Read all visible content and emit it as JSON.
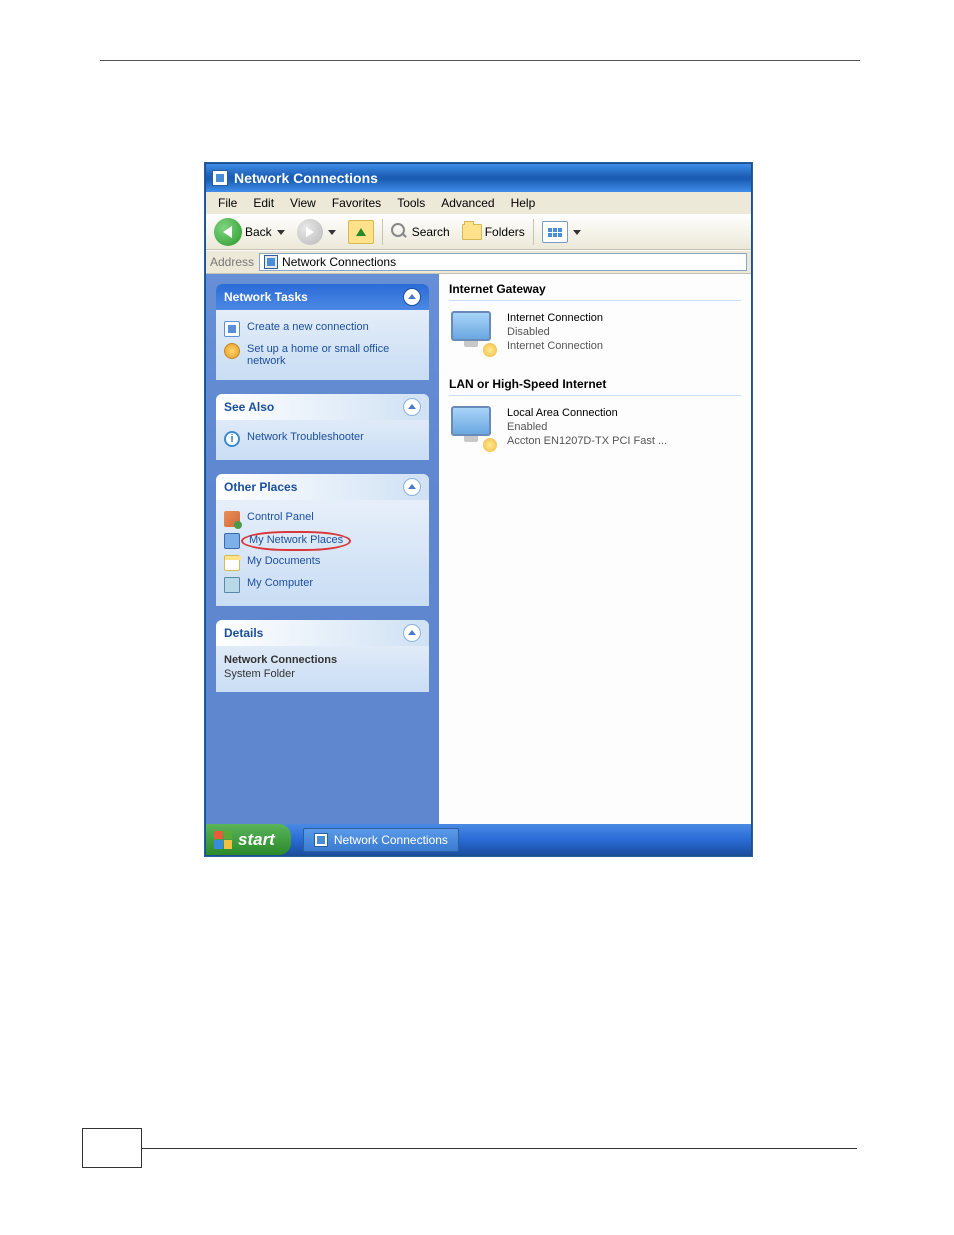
{
  "window_title": "Network Connections",
  "menu": {
    "file": "File",
    "edit": "Edit",
    "view": "View",
    "favorites": "Favorites",
    "tools": "Tools",
    "advanced": "Advanced",
    "help": "Help"
  },
  "toolbar": {
    "back": "Back",
    "search": "Search",
    "folders": "Folders"
  },
  "addressbar": {
    "label": "Address",
    "value": "Network Connections"
  },
  "sidebar": {
    "tasks": {
      "title": "Network Tasks",
      "items": [
        {
          "label": "Create a new connection"
        },
        {
          "label": "Set up a home or small office network"
        }
      ]
    },
    "seealso": {
      "title": "See Also",
      "items": [
        {
          "label": "Network Troubleshooter"
        }
      ]
    },
    "other": {
      "title": "Other Places",
      "items": [
        {
          "label": "Control Panel"
        },
        {
          "label": "My Network Places"
        },
        {
          "label": "My Documents"
        },
        {
          "label": "My Computer"
        }
      ]
    },
    "details": {
      "title": "Details",
      "name": "Network Connections",
      "type": "System Folder"
    }
  },
  "content": {
    "group1": {
      "title": "Internet Gateway",
      "item": {
        "name": "Internet Connection",
        "status": "Disabled",
        "device": "Internet Connection"
      }
    },
    "group2": {
      "title": "LAN or High-Speed Internet",
      "item": {
        "name": "Local Area Connection",
        "status": "Enabled",
        "device": "Accton EN1207D-TX PCI Fast ..."
      }
    }
  },
  "taskbar": {
    "start": "start",
    "task1": "Network Connections"
  }
}
